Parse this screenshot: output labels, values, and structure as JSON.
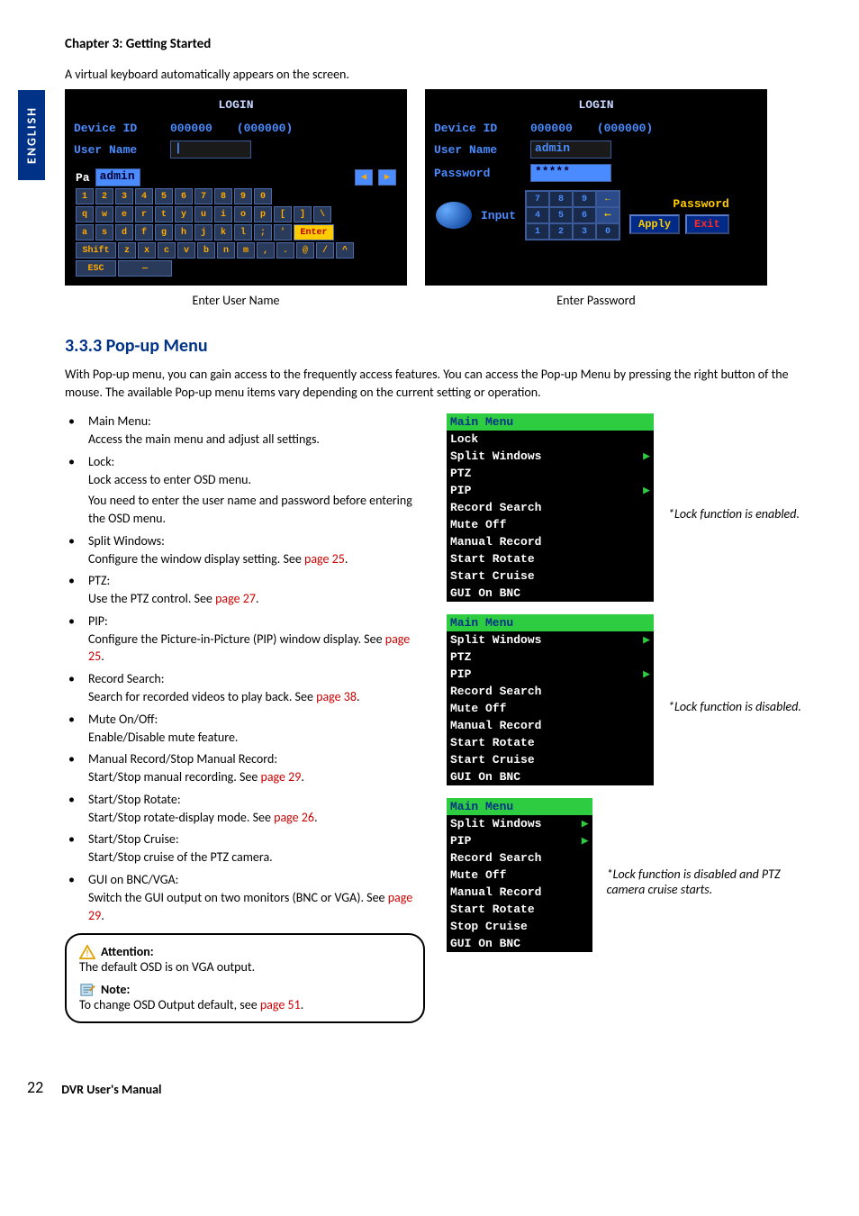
{
  "side_tab": "ENGLISH",
  "chapter": "Chapter 3: Getting Started",
  "intro": "A virtual keyboard automatically appears on the screen.",
  "login1": {
    "title": "LOGIN",
    "device_id_label": "Device ID",
    "device_id_value": "000000",
    "device_id_paren": "(000000)",
    "user_name_label": "User Name",
    "field_prefix": "Pa",
    "field_text": "admin",
    "keys_row1": [
      "1",
      "2",
      "3",
      "4",
      "5",
      "6",
      "7",
      "8",
      "9",
      "0"
    ],
    "keys_row2": [
      "q",
      "w",
      "e",
      "r",
      "t",
      "y",
      "u",
      "i",
      "o",
      "p",
      "[",
      "]",
      "\\"
    ],
    "keys_row3": [
      "a",
      "s",
      "d",
      "f",
      "g",
      "h",
      "j",
      "k",
      "l",
      ";",
      "'"
    ],
    "enter": "Enter",
    "keys_row4": [
      "Shift",
      "z",
      "x",
      "c",
      "v",
      "b",
      "n",
      "m",
      ",",
      ".",
      "@",
      "/",
      "^"
    ],
    "keys_row5": "ESC"
  },
  "login2": {
    "title": "LOGIN",
    "device_id_label": "Device ID",
    "device_id_value": "000000",
    "device_id_paren": "(000000)",
    "user_name_label": "User Name",
    "user_name_value": "admin",
    "password_label": "Password",
    "password_value": "*****",
    "input_label": "Input",
    "keypad": [
      [
        "7",
        "8",
        "9",
        "←"
      ],
      [
        "4",
        "5",
        "6",
        "⟵"
      ],
      [
        "1",
        "2",
        "3",
        "0"
      ]
    ],
    "side_label": "Password",
    "apply": "Apply",
    "exit": "Exit"
  },
  "caption1": "Enter User Name",
  "caption2": "Enter Password",
  "section": "3.3.3 Pop-up Menu",
  "section_intro": "With Pop-up menu, you can gain access to the frequently access features. You can access the Pop-up Menu by pressing the right button of the mouse.  The available Pop-up menu items vary depending on the current setting or operation.",
  "features": [
    {
      "name": "Main Menu:",
      "desc": "Access the main menu and adjust all settings."
    },
    {
      "name": "Lock:",
      "desc1": "Lock access to enter OSD menu.",
      "desc2": "You need to enter the user name and password before entering the OSD menu."
    },
    {
      "name": "Split Windows:",
      "desc": "Configure the window display setting. See ",
      "link": "page 25",
      "tail": "."
    },
    {
      "name": "PTZ:",
      "desc": "Use the PTZ control. See ",
      "link": "page 27",
      "tail": "."
    },
    {
      "name": "PIP:",
      "desc": "Configure the Picture-in-Picture (PIP) window display. See ",
      "link": "page 25",
      "tail": "."
    },
    {
      "name": "Record Search:",
      "desc": "Search for recorded videos to play back. See ",
      "link": "page 38",
      "tail": "."
    },
    {
      "name": "Mute On/Off:",
      "desc": "Enable/Disable mute feature."
    },
    {
      "name": "Manual Record/Stop Manual Record:",
      "desc": "Start/Stop manual recording. See ",
      "link": "page 29",
      "tail": "."
    },
    {
      "name": "Start/Stop Rotate:",
      "desc": "Start/Stop rotate-display mode. See ",
      "link": "page 26",
      "tail": "."
    },
    {
      "name": "Start/Stop Cruise:",
      "desc": "Start/Stop cruise of the PTZ camera."
    },
    {
      "name": "GUI on BNC/VGA:",
      "desc": "Switch the GUI output on two monitors (BNC or VGA). See ",
      "link": "page 29",
      "tail": "."
    }
  ],
  "callout": {
    "att_title": "Attention:",
    "att_body": "The default OSD is on VGA output.",
    "note_title": "Note:",
    "note_body": "To change OSD Output default, see ",
    "note_link": "page 51",
    "note_tail": "."
  },
  "menu1": {
    "title": "Main  Menu",
    "items": [
      "Lock",
      "Split  Windows",
      "PTZ",
      "PIP",
      "Record  Search",
      "Mute  Off",
      "Manual  Record",
      "Start  Rotate",
      "Start  Cruise",
      "GUI  On  BNC"
    ],
    "arrows": [
      1,
      3
    ],
    "note": "*Lock function is enabled."
  },
  "menu2": {
    "title": "Main  Menu",
    "items": [
      "Split  Windows",
      "PTZ",
      "PIP",
      "Record  Search",
      "Mute  Off",
      "Manual  Record",
      "Start  Rotate",
      "Start  Cruise",
      "GUI  On  BNC"
    ],
    "arrows": [
      0,
      2
    ],
    "note": "*Lock function is disabled."
  },
  "menu3": {
    "title": "Main  Menu",
    "items": [
      "Split  Windows",
      "PIP",
      "Record  Search",
      "Mute  Off",
      "Manual  Record",
      "Start  Rotate",
      "Stop  Cruise",
      "GUI  On  BNC"
    ],
    "arrows": [
      0,
      1
    ],
    "note": "*Lock function is disabled and PTZ camera cruise starts."
  },
  "footer": {
    "page": "22",
    "manual": "DVR User's Manual"
  }
}
